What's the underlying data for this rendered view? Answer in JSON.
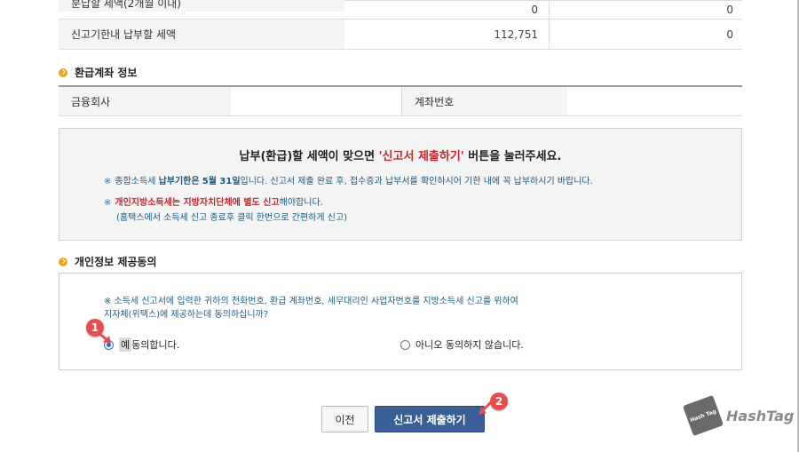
{
  "tax_table": {
    "rows": [
      {
        "label": "분납할 세액(2개월 이내)",
        "value": "0",
        "value2": "0"
      },
      {
        "label": "신고기한내 납부할 세액",
        "value": "112,751",
        "value2": "0"
      }
    ]
  },
  "refund_section": {
    "title": "환급계좌 정보",
    "bank_label": "금융회사",
    "bank_value": "",
    "account_label": "계좌번호",
    "account_value": ""
  },
  "notice": {
    "title_prefix": "납부(환급)할 세액이 맞으면 ",
    "title_highlight": "'신고서 제출하기'",
    "title_suffix": " 버튼을 눌러주세요.",
    "line1_star": "※",
    "line1_a": "종합소득세 ",
    "line1_b": "납부기한은",
    "line1_c": " ",
    "line1_d": "5월 31일",
    "line1_e": "입니다. 신고서 제출 완료 후, 접수증과 납부서를 확인하시어 기한 내에 꼭 납부하시기 바랍니다.",
    "line2_star": "※",
    "line2_red": "개인지방소득세는 지방자치단체에 별도 신고",
    "line2_rest": "해야합니다.",
    "line3": "(홈택스에서 소득세 신고 종료후 클릭 한번으로 간편하게 신고)"
  },
  "consent_section": {
    "title": "개인정보 제공동의",
    "text_line1": "※ 소득세 신고서에 입력한 귀하의 전화번호, 환급 계좌번호, 세무대리인 사업자번호를 지방소득세 신고를 위하여",
    "text_line2": "지자체(위택스)에 제공하는데 동의하십니까?",
    "yes_prefix": "예",
    "yes_label": " 동의합니다.",
    "no_label": "아니오 동의하지 않습니다.",
    "selected": "yes"
  },
  "badges": {
    "one": "1",
    "two": "2"
  },
  "buttons": {
    "prev": "이전",
    "submit": "신고서 제출하기"
  },
  "watermark": {
    "tag": "Hash Tag",
    "text": "HashTag"
  },
  "colors": {
    "accent": "#3a5f96",
    "highlight_red": "#c0282d",
    "badge": "#e84c4c",
    "bullet": "#f0a21b"
  }
}
